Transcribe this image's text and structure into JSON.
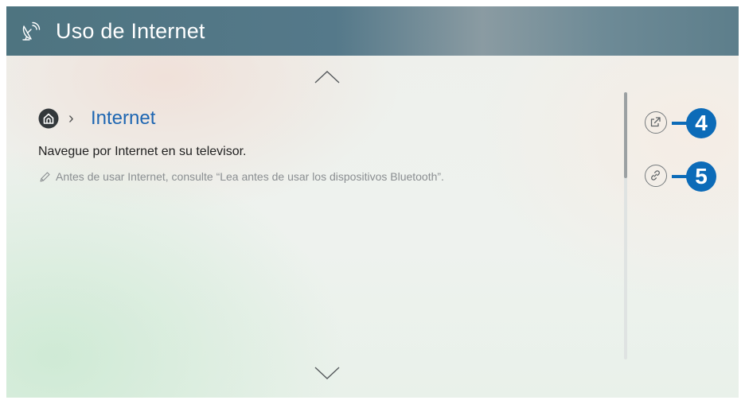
{
  "header": {
    "title": "Uso de Internet",
    "icon": "satellite-dish-icon"
  },
  "breadcrumb": {
    "home_icon": "home-icon",
    "separator": "›",
    "current": "Internet"
  },
  "content": {
    "description": "Navegue por Internet en su televisor.",
    "note_icon": "pencil-icon",
    "note": "Antes de usar Internet, consulte “Lea antes de usar los dispositivos Bluetooth”."
  },
  "actions": [
    {
      "icon": "external-open-icon",
      "callout": "4"
    },
    {
      "icon": "link-icon",
      "callout": "5"
    }
  ],
  "colors": {
    "header": "#55798a",
    "link": "#1e66b2",
    "callout": "#0c6bb8"
  }
}
